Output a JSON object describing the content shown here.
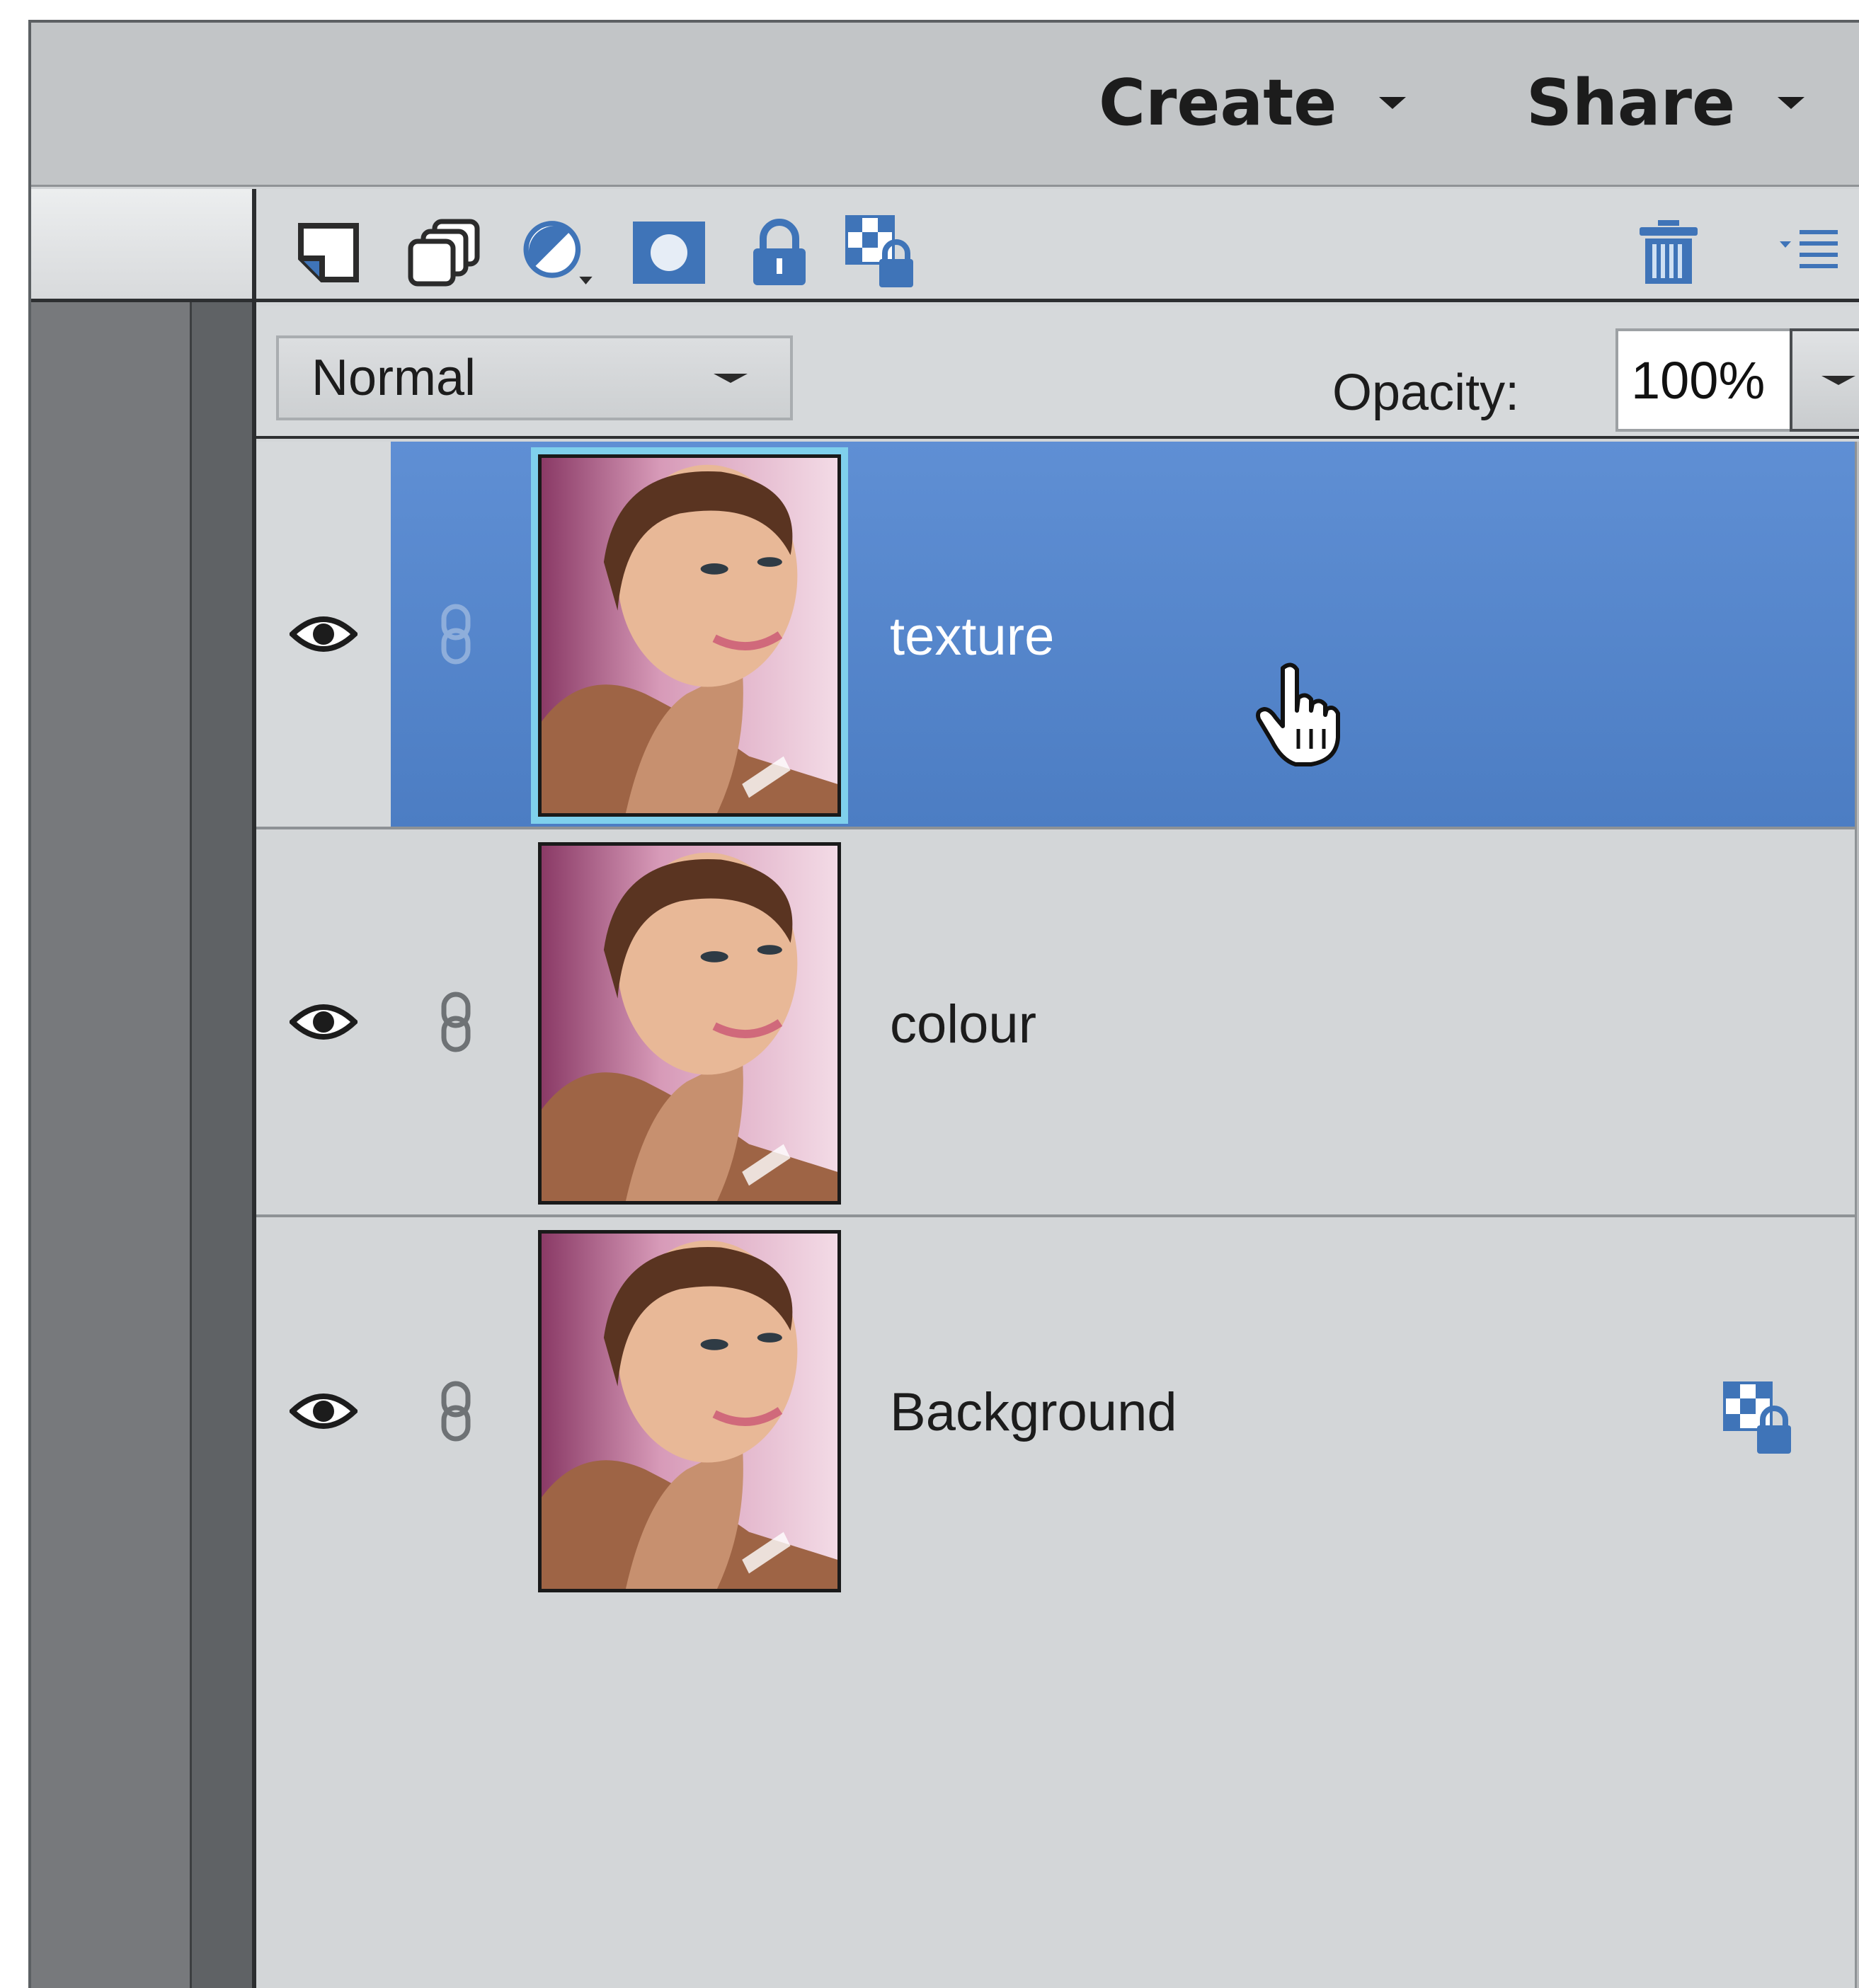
{
  "topbar": {
    "create_label": "Create",
    "share_label": "Share"
  },
  "toolbar": {
    "icons": [
      "new-layer-icon",
      "new-group-icon",
      "adjustment-layer-icon",
      "layer-mask-icon",
      "lock-all-icon",
      "lock-transparent-icon",
      "trash-icon",
      "panel-menu-icon"
    ]
  },
  "blend_mode": {
    "selected": "Normal"
  },
  "opacity": {
    "label": "Opacity:",
    "value": "100%"
  },
  "layers": [
    {
      "name": "texture",
      "selected": true,
      "visible": true,
      "locked": false
    },
    {
      "name": "colour",
      "selected": false,
      "visible": true,
      "locked": false
    },
    {
      "name": "Background",
      "selected": false,
      "visible": true,
      "locked": true
    }
  ],
  "colors": {
    "selection": "#5f8fd4",
    "panel": "#d3d6d8",
    "icon_blue": "#3f74b8",
    "thumb_highlight": "#7fd0ec"
  }
}
